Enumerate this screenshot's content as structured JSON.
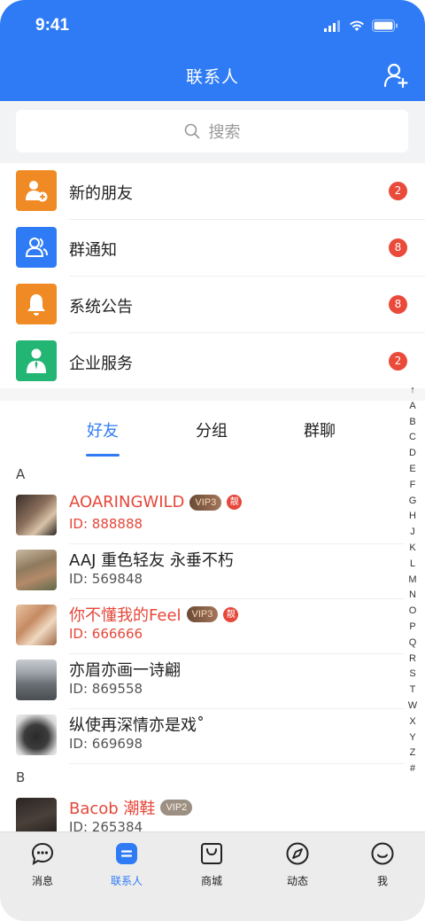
{
  "status_bar": {
    "time": "9:41"
  },
  "header": {
    "title": "联系人"
  },
  "search": {
    "placeholder": "搜索"
  },
  "menu": [
    {
      "label": "新的朋友",
      "badge": "2",
      "icon": "add-friend-icon",
      "color": "#f08a24"
    },
    {
      "label": "群通知",
      "badge": "8",
      "icon": "group-icon",
      "color": "#2f7bf5"
    },
    {
      "label": "系统公告",
      "badge": "8",
      "icon": "bell-icon",
      "color": "#f08a24"
    },
    {
      "label": "企业服务",
      "badge": "2",
      "icon": "business-person-icon",
      "color": "#22b573"
    }
  ],
  "tabs": [
    {
      "label": "好友",
      "active": true
    },
    {
      "label": "分组",
      "active": false
    },
    {
      "label": "群聊",
      "active": false
    }
  ],
  "sections": [
    {
      "letter": "A",
      "contacts": [
        {
          "name": "AOARINGWILD",
          "id": "ID: 888888",
          "vip": "VIP3",
          "ad": "靓"
        },
        {
          "name": "AAJ 重色轻友 永垂不朽",
          "id": "ID: 569848"
        },
        {
          "name": "你不懂我的Feel",
          "id": "ID: 666666",
          "vip": "VIP3",
          "ad": "靓"
        },
        {
          "name": "亦眉亦画一诗翩",
          "id": "ID: 869558"
        },
        {
          "name": "纵使再深情亦是戏˚",
          "id": "ID: 669698"
        }
      ]
    },
    {
      "letter": "B",
      "contacts": [
        {
          "name": "Bacob 潮鞋",
          "id": "ID: 265384",
          "vip": "VIP2"
        }
      ]
    }
  ],
  "index_letters": [
    "↑",
    "A",
    "B",
    "C",
    "D",
    "E",
    "F",
    "G",
    "H",
    "J",
    "K",
    "L",
    "M",
    "N",
    "O",
    "P",
    "Q",
    "R",
    "S",
    "T",
    "W",
    "X",
    "Y",
    "Z",
    "#"
  ],
  "bottom_nav": [
    {
      "label": "消息",
      "icon": "chat-bubble-icon"
    },
    {
      "label": "联系人",
      "icon": "contacts-icon",
      "active": true
    },
    {
      "label": "商城",
      "icon": "shopping-bag-icon"
    },
    {
      "label": "动态",
      "icon": "compass-icon"
    },
    {
      "label": "我",
      "icon": "smiley-icon"
    }
  ],
  "colors": {
    "primary": "#2f7bf5",
    "badge": "#ea4a3a",
    "vip_name": "#e5473a"
  }
}
